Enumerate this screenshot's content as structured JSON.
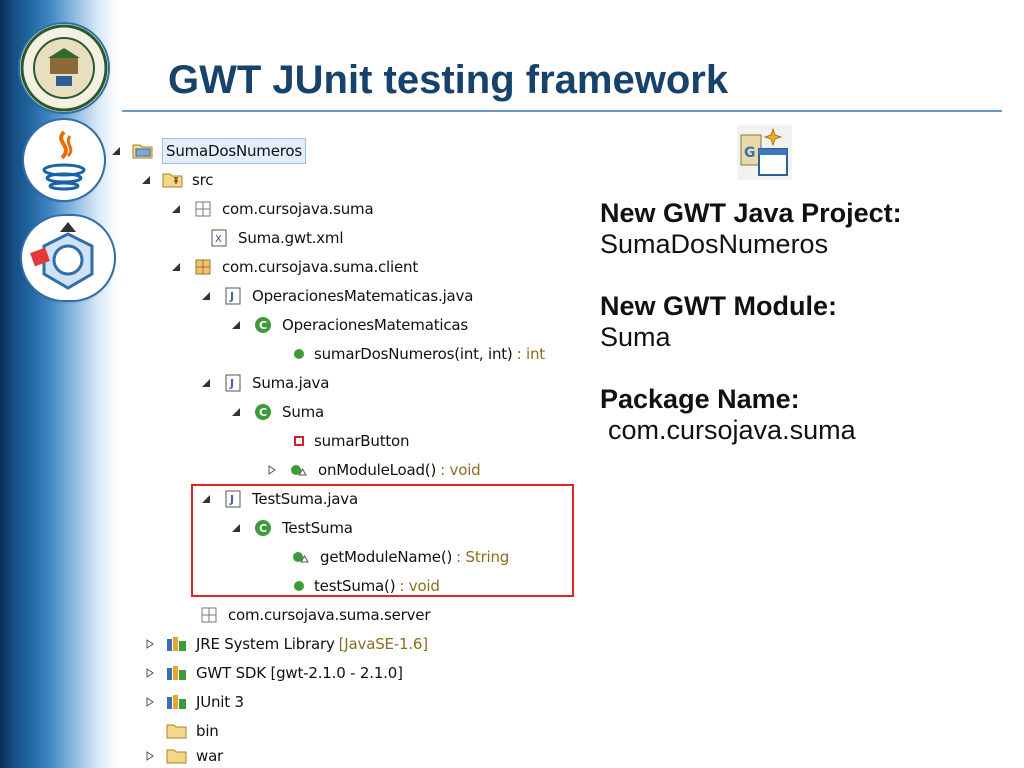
{
  "slide": {
    "title": "GWT JUnit testing framework"
  },
  "tree": {
    "root": "SumaDosNumeros",
    "src": "src",
    "pkg_suma": "com.cursojava.suma",
    "suma_gwt_xml": "Suma.gwt.xml",
    "pkg_client": "com.cursojava.suma.client",
    "operaciones_java": "OperacionesMatematicas.java",
    "operaciones_class": "OperacionesMatematicas",
    "sumar_method": "sumarDosNumeros(int, int)",
    "sumar_method_suffix": ": int",
    "suma_java": "Suma.java",
    "suma_class": "Suma",
    "sumar_button": "sumarButton",
    "on_module_load": "onModuleLoad()",
    "on_module_load_suffix": ": void",
    "testsuma_java": "TestSuma.java",
    "testsuma_class": "TestSuma",
    "get_module_name": "getModuleName()",
    "get_module_name_suffix": ": String",
    "test_suma": "testSuma()",
    "test_suma_suffix": ": void",
    "pkg_server": "com.cursojava.suma.server",
    "jre_lib": "JRE System Library",
    "jre_lib_suffix": "[JavaSE-1.6]",
    "gwt_sdk": "GWT SDK [gwt-2.1.0 - 2.1.0]",
    "junit": "JUnit 3",
    "bin": "bin",
    "war": "war"
  },
  "info": {
    "project_heading": "New GWT Java Project:",
    "project_value": "SumaDosNumeros",
    "module_heading": "New GWT Module:",
    "module_value": "Suma",
    "package_heading": "Package Name:",
    "package_value": "com.cursojava.suma"
  },
  "colors": {
    "title": "#17426b",
    "highlight_box": "#e0242a",
    "type_suffix": "#8a6d1e"
  },
  "icons": {
    "badges": [
      "university-seal-icon",
      "java-logo-icon",
      "gwt-logo-icon"
    ],
    "wizard": "new-gwt-project-wizard-icon"
  }
}
